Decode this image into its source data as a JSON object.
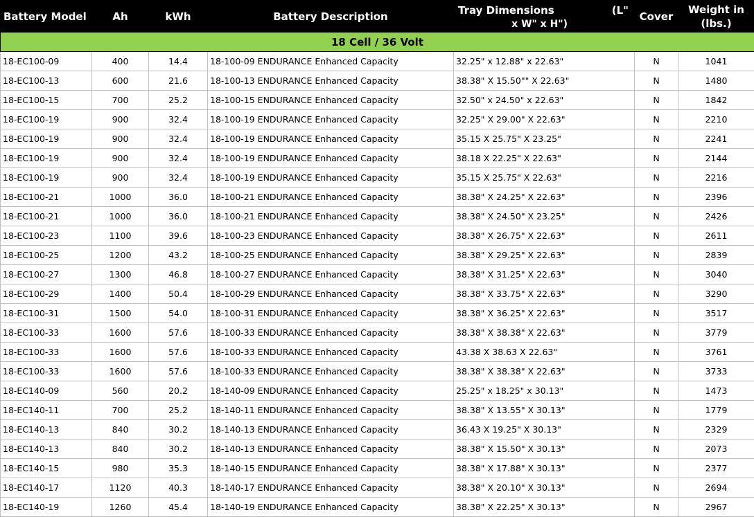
{
  "headers": {
    "model": "Battery Model",
    "ah": "Ah",
    "kwh": "kWh",
    "description": "Battery Description",
    "tray_title": "Tray Dimensions",
    "tray_l": "(L\"",
    "tray_sub": "x W\" x H\")",
    "cover": "Cover",
    "weight_line1": "Weight in",
    "weight_line2": "(lbs.)"
  },
  "section_title": "18 Cell / 36 Volt",
  "rows": [
    {
      "model": "18-EC100-09",
      "ah": "400",
      "kwh": "14.4",
      "desc": "18-100-09 ENDURANCE Enhanced Capacity",
      "tray": "32.25\" x 12.88\" x 22.63\"",
      "cover": "N",
      "weight": "1041"
    },
    {
      "model": "18-EC100-13",
      "ah": "600",
      "kwh": "21.6",
      "desc": "18-100-13 ENDURANCE Enhanced Capacity",
      "tray": "38.38\" X 15.50\"\" X 22.63\"",
      "cover": "N",
      "weight": "1480"
    },
    {
      "model": "18-EC100-15",
      "ah": "700",
      "kwh": "25.2",
      "desc": "18-100-15 ENDURANCE Enhanced Capacity",
      "tray": "32.50\" x 24.50\" x 22.63\"",
      "cover": "N",
      "weight": "1842"
    },
    {
      "model": "18-EC100-19",
      "ah": "900",
      "kwh": "32.4",
      "desc": "18-100-19 ENDURANCE Enhanced Capacity",
      "tray": "32.25\" X 29.00\" X 22.63\"",
      "cover": "N",
      "weight": "2210"
    },
    {
      "model": "18-EC100-19",
      "ah": "900",
      "kwh": "32.4",
      "desc": "18-100-19 ENDURANCE Enhanced Capacity",
      "tray": "35.15 X 25.75\" X 23.25\"",
      "cover": "N",
      "weight": "2241"
    },
    {
      "model": "18-EC100-19",
      "ah": "900",
      "kwh": "32.4",
      "desc": "18-100-19 ENDURANCE Enhanced Capacity",
      "tray": "38.18 X 22.25\" X 22.63\"",
      "cover": "N",
      "weight": "2144"
    },
    {
      "model": "18-EC100-19",
      "ah": "900",
      "kwh": "32.4",
      "desc": "18-100-19 ENDURANCE Enhanced Capacity",
      "tray": "35.15 X 25.75\" X 22.63\"",
      "cover": "N",
      "weight": "2216"
    },
    {
      "model": "18-EC100-21",
      "ah": "1000",
      "kwh": "36.0",
      "desc": "18-100-21 ENDURANCE Enhanced Capacity",
      "tray": "38.38\" X 24.25\" X 22.63\"",
      "cover": "N",
      "weight": "2396"
    },
    {
      "model": "18-EC100-21",
      "ah": "1000",
      "kwh": "36.0",
      "desc": "18-100-21 ENDURANCE Enhanced Capacity",
      "tray": "38.38\" X 24.50\" X 23.25\"",
      "cover": "N",
      "weight": "2426"
    },
    {
      "model": "18-EC100-23",
      "ah": "1100",
      "kwh": "39.6",
      "desc": "18-100-23 ENDURANCE Enhanced Capacity",
      "tray": "38.38\" X 26.75\" X 22.63\"",
      "cover": "N",
      "weight": "2611"
    },
    {
      "model": "18-EC100-25",
      "ah": "1200",
      "kwh": "43.2",
      "desc": "18-100-25 ENDURANCE Enhanced Capacity",
      "tray": "38.38\" X 29.25\" X 22.63\"",
      "cover": "N",
      "weight": "2839"
    },
    {
      "model": "18-EC100-27",
      "ah": "1300",
      "kwh": "46.8",
      "desc": "18-100-27 ENDURANCE Enhanced Capacity",
      "tray": "38.38\" X 31.25\" X 22.63\"",
      "cover": "N",
      "weight": "3040"
    },
    {
      "model": "18-EC100-29",
      "ah": "1400",
      "kwh": "50.4",
      "desc": "18-100-29 ENDURANCE Enhanced Capacity",
      "tray": "38.38\" X 33.75\" X 22.63\"",
      "cover": "N",
      "weight": "3290"
    },
    {
      "model": "18-EC100-31",
      "ah": "1500",
      "kwh": "54.0",
      "desc": "18-100-31 ENDURANCE Enhanced Capacity",
      "tray": "38.38\" X 36.25\" X 22.63\"",
      "cover": "N",
      "weight": "3517"
    },
    {
      "model": "18-EC100-33",
      "ah": "1600",
      "kwh": "57.6",
      "desc": "18-100-33 ENDURANCE Enhanced Capacity",
      "tray": "38.38\" X 38.38\" X 22.63\"",
      "cover": "N",
      "weight": "3779"
    },
    {
      "model": "18-EC100-33",
      "ah": "1600",
      "kwh": "57.6",
      "desc": "18-100-33 ENDURANCE Enhanced Capacity",
      "tray": "43.38 X 38.63 X 22.63\"",
      "cover": "N",
      "weight": "3761"
    },
    {
      "model": "18-EC100-33",
      "ah": "1600",
      "kwh": "57.6",
      "desc": "18-100-33 ENDURANCE Enhanced Capacity",
      "tray": "38.38\" X 38.38\" X 22.63\"",
      "cover": "N",
      "weight": "3733"
    },
    {
      "model": "18-EC140-09",
      "ah": "560",
      "kwh": "20.2",
      "desc": "18-140-09 ENDURANCE Enhanced Capacity",
      "tray": "25.25\" x 18.25\" x 30.13\"",
      "cover": "N",
      "weight": "1473"
    },
    {
      "model": "18-EC140-11",
      "ah": "700",
      "kwh": "25.2",
      "desc": "18-140-11 ENDURANCE Enhanced Capacity",
      "tray": "38.38\" X 13.55\" X 30.13\"",
      "cover": "N",
      "weight": "1779"
    },
    {
      "model": "18-EC140-13",
      "ah": "840",
      "kwh": "30.2",
      "desc": "18-140-13 ENDURANCE Enhanced Capacity",
      "tray": "36.43 X 19.25\" X 30.13\"",
      "cover": "N",
      "weight": "2329"
    },
    {
      "model": "18-EC140-13",
      "ah": "840",
      "kwh": "30.2",
      "desc": "18-140-13 ENDURANCE Enhanced Capacity",
      "tray": "38.38\" X 15.50\" X 30.13\"",
      "cover": "N",
      "weight": "2073"
    },
    {
      "model": "18-EC140-15",
      "ah": "980",
      "kwh": "35.3",
      "desc": "18-140-15 ENDURANCE Enhanced Capacity",
      "tray": "38.38\" X 17.88\" X 30.13\"",
      "cover": "N",
      "weight": "2377"
    },
    {
      "model": "18-EC140-17",
      "ah": "1120",
      "kwh": "40.3",
      "desc": "18-140-17 ENDURANCE Enhanced Capacity",
      "tray": "38.38\" X 20.10\" X 30.13\"",
      "cover": "N",
      "weight": "2694"
    },
    {
      "model": "18-EC140-19",
      "ah": "1260",
      "kwh": "45.4",
      "desc": "18-140-19 ENDURANCE Enhanced Capacity",
      "tray": "38.38\" X 22.25\" X 30.13\"",
      "cover": "N",
      "weight": "2967"
    }
  ]
}
